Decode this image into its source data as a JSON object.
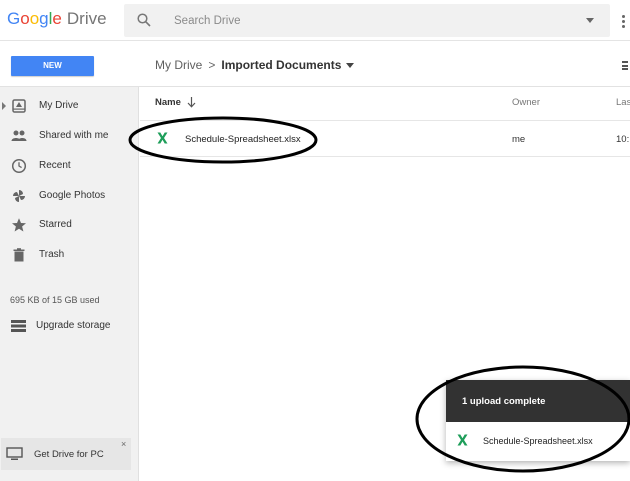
{
  "header": {
    "logo_letters": [
      "G",
      "o",
      "o",
      "g",
      "l",
      "e"
    ],
    "logo_product": "Drive",
    "search_placeholder": "Search Drive"
  },
  "toolbar": {
    "new_label": "NEW"
  },
  "breadcrumb": {
    "parent": "My Drive",
    "separator": ">",
    "current": "Imported Documents"
  },
  "sidebar": {
    "items": [
      {
        "label": "My Drive",
        "icon": "drive-icon"
      },
      {
        "label": "Shared with me",
        "icon": "people-icon"
      },
      {
        "label": "Recent",
        "icon": "clock-icon"
      },
      {
        "label": "Google Photos",
        "icon": "pinwheel-icon"
      },
      {
        "label": "Starred",
        "icon": "star-icon"
      },
      {
        "label": "Trash",
        "icon": "trash-icon"
      }
    ],
    "storage_text": "695 KB of 15 GB used",
    "upgrade_label": "Upgrade storage",
    "get_drive_label": "Get Drive for PC",
    "get_drive_close": "×"
  },
  "file_list": {
    "columns": {
      "name": "Name",
      "owner": "Owner",
      "last_modified": "Last modified"
    },
    "rows": [
      {
        "name": "Schedule-Spreadsheet.xlsx",
        "owner": "me",
        "modified": "10:"
      }
    ]
  },
  "upload_panel": {
    "title": "1 upload complete",
    "files": [
      "Schedule-Spreadsheet.xlsx"
    ]
  },
  "colors": {
    "accent": "#4285f4",
    "excel_green": "#1e9e5a",
    "sidebar_bg": "#f1f1f1",
    "upload_header_bg": "#323232"
  }
}
